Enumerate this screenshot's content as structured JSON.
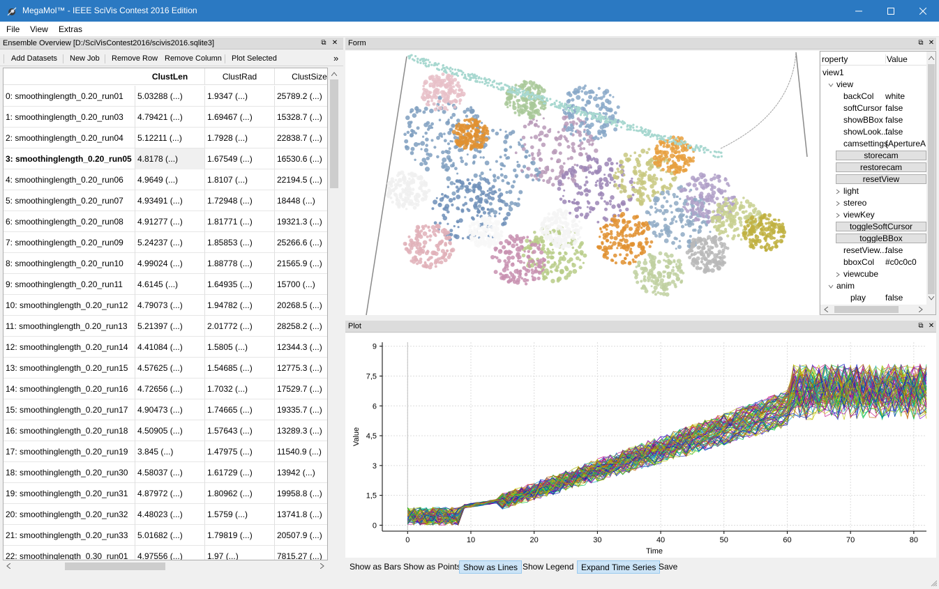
{
  "window": {
    "title": "MegaMol™ - IEEE SciVis Contest 2016 Edition"
  },
  "menu": [
    "File",
    "View",
    "Extras"
  ],
  "ensemble": {
    "title": "Ensemble Overview [D:/SciVisContest2016/scivis2016.sqlite3]",
    "toolbar": [
      "Add Datasets",
      "New Job",
      "Remove Row",
      "Remove Column",
      "Plot Selected"
    ],
    "more": "»",
    "columns": [
      "ClustLen",
      "ClustRad",
      "ClustSize"
    ],
    "rows": [
      {
        "name": "0: smoothinglength_0.20_run01",
        "c1": "5.03288  (...)",
        "c2": "1.9347  (...)",
        "c3": "25789.2  (...)"
      },
      {
        "name": "1: smoothinglength_0.20_run03",
        "c1": "4.79421  (...)",
        "c2": "1.69467  (...)",
        "c3": "15328.7  (...)"
      },
      {
        "name": "2: smoothinglength_0.20_run04",
        "c1": "5.12211  (...)",
        "c2": "1.7928  (...)",
        "c3": "22838.7  (...)"
      },
      {
        "name": "3: smoothinglength_0.20_run05",
        "c1": "4.8178  (...)",
        "c2": "1.67549  (...)",
        "c3": "16530.6  (...)"
      },
      {
        "name": "4: smoothinglength_0.20_run06",
        "c1": "4.9649  (...)",
        "c2": "1.8107  (...)",
        "c3": "22194.5  (...)"
      },
      {
        "name": "5: smoothinglength_0.20_run07",
        "c1": "4.93491  (...)",
        "c2": "1.72948  (...)",
        "c3": "18448  (...)"
      },
      {
        "name": "6: smoothinglength_0.20_run08",
        "c1": "4.91277  (...)",
        "c2": "1.81771  (...)",
        "c3": "19321.3  (...)"
      },
      {
        "name": "7: smoothinglength_0.20_run09",
        "c1": "5.24237  (...)",
        "c2": "1.85853  (...)",
        "c3": "25266.6  (...)"
      },
      {
        "name": "8: smoothinglength_0.20_run10",
        "c1": "4.99024  (...)",
        "c2": "1.88778  (...)",
        "c3": "21565.9  (...)"
      },
      {
        "name": "9: smoothinglength_0.20_run11",
        "c1": "4.6145  (...)",
        "c2": "1.64935  (...)",
        "c3": "15700  (...)"
      },
      {
        "name": "10: smoothinglength_0.20_run12",
        "c1": "4.79073  (...)",
        "c2": "1.94782  (...)",
        "c3": "20268.5  (...)"
      },
      {
        "name": "11: smoothinglength_0.20_run13",
        "c1": "5.21397  (...)",
        "c2": "2.01772  (...)",
        "c3": "28258.2  (...)"
      },
      {
        "name": "12: smoothinglength_0.20_run14",
        "c1": "4.41084  (...)",
        "c2": "1.5805  (...)",
        "c3": "12344.3  (...)"
      },
      {
        "name": "13: smoothinglength_0.20_run15",
        "c1": "4.57625  (...)",
        "c2": "1.54685  (...)",
        "c3": "12775.3  (...)"
      },
      {
        "name": "14: smoothinglength_0.20_run16",
        "c1": "4.72656  (...)",
        "c2": "1.7032  (...)",
        "c3": "17529.7  (...)"
      },
      {
        "name": "15: smoothinglength_0.20_run17",
        "c1": "4.90473  (...)",
        "c2": "1.74665  (...)",
        "c3": "19335.7  (...)"
      },
      {
        "name": "16: smoothinglength_0.20_run18",
        "c1": "4.50905  (...)",
        "c2": "1.57643  (...)",
        "c3": "13289.3  (...)"
      },
      {
        "name": "17: smoothinglength_0.20_run19",
        "c1": "3.845  (...)",
        "c2": "1.47975  (...)",
        "c3": "11540.9  (...)"
      },
      {
        "name": "18: smoothinglength_0.20_run30",
        "c1": "4.58037  (...)",
        "c2": "1.61729  (...)",
        "c3": "13942  (...)"
      },
      {
        "name": "19: smoothinglength_0.20_run31",
        "c1": "4.87972  (...)",
        "c2": "1.80962  (...)",
        "c3": "19958.8  (...)"
      },
      {
        "name": "20: smoothinglength_0.20_run32",
        "c1": "4.48023  (...)",
        "c2": "1.5759  (...)",
        "c3": "13741.8  (...)"
      },
      {
        "name": "21: smoothinglength_0.20_run33",
        "c1": "5.01682  (...)",
        "c2": "1.79819  (...)",
        "c3": "20507.9  (...)"
      },
      {
        "name": "22: smoothinglength_0.30_run01",
        "c1": "4.97556  (...)",
        "c2": "1.97  (...)",
        "c3": "7815.27  (...)"
      }
    ],
    "selected_row": 3
  },
  "form": {
    "title": "Form"
  },
  "properties": {
    "col_property": "roperty",
    "col_value": "Value",
    "rows": [
      {
        "kind": "item",
        "indent": 0,
        "arrow": "",
        "name": "view1",
        "value": ""
      },
      {
        "kind": "item",
        "indent": 1,
        "arrow": "v",
        "name": "view",
        "value": ""
      },
      {
        "kind": "item",
        "indent": 2,
        "arrow": "",
        "name": "backCol",
        "value": "white"
      },
      {
        "kind": "item",
        "indent": 2,
        "arrow": "",
        "name": "softCursor",
        "value": "false"
      },
      {
        "kind": "item",
        "indent": 2,
        "arrow": "",
        "name": "showBBox",
        "value": "false"
      },
      {
        "kind": "item",
        "indent": 2,
        "arrow": "",
        "name": "showLook...",
        "value": "false"
      },
      {
        "kind": "item",
        "indent": 2,
        "arrow": "",
        "name": "camsettings",
        "value": "{ApertureA"
      },
      {
        "kind": "button",
        "name": "storecam"
      },
      {
        "kind": "button",
        "name": "restorecam"
      },
      {
        "kind": "button",
        "name": "resetView"
      },
      {
        "kind": "item",
        "indent": 2,
        "arrow": ">",
        "name": "light",
        "value": ""
      },
      {
        "kind": "item",
        "indent": 2,
        "arrow": ">",
        "name": "stereo",
        "value": ""
      },
      {
        "kind": "item",
        "indent": 2,
        "arrow": ">",
        "name": "viewKey",
        "value": ""
      },
      {
        "kind": "button",
        "name": "toggleSoftCursor"
      },
      {
        "kind": "button",
        "name": "toggleBBox"
      },
      {
        "kind": "item",
        "indent": 2,
        "arrow": "",
        "name": "resetView...",
        "value": "false"
      },
      {
        "kind": "item",
        "indent": 2,
        "arrow": "",
        "name": "bboxCol",
        "value": "#c0c0c0"
      },
      {
        "kind": "item",
        "indent": 2,
        "arrow": ">",
        "name": "viewcube",
        "value": ""
      },
      {
        "kind": "item",
        "indent": 1,
        "arrow": "v",
        "name": "anim",
        "value": ""
      },
      {
        "kind": "item",
        "indent": 3,
        "arrow": "",
        "name": "play",
        "value": "false"
      }
    ]
  },
  "plot": {
    "title": "Plot",
    "buttons": [
      {
        "label": "Show as Bars",
        "active": false
      },
      {
        "label": "Show as Points",
        "active": false
      },
      {
        "label": "Show as Lines",
        "active": true
      },
      {
        "label": "Show Legend",
        "active": false
      },
      {
        "label": "Expand Time Series",
        "active": true
      },
      {
        "label": "Save",
        "active": false
      }
    ]
  },
  "chart_data": {
    "type": "line",
    "title": "",
    "xlabel": "Time",
    "ylabel": "Value",
    "xlim": [
      -4,
      82
    ],
    "ylim": [
      -0.3,
      9.2
    ],
    "xticks": [
      0,
      10,
      20,
      30,
      40,
      50,
      60,
      70,
      80
    ],
    "yticks": [
      0,
      1.5,
      3,
      4.5,
      6,
      7.5,
      9
    ],
    "ytick_labels": [
      "0",
      "1,5",
      "3",
      "4,5",
      "6",
      "7,5",
      "9"
    ],
    "grid": true,
    "series_count": 80,
    "colors": [
      "#c00080",
      "#0020c0",
      "#00c040",
      "#c0c000",
      "#00a0c0",
      "#8000c0",
      "#c06000",
      "#a0c000"
    ]
  }
}
